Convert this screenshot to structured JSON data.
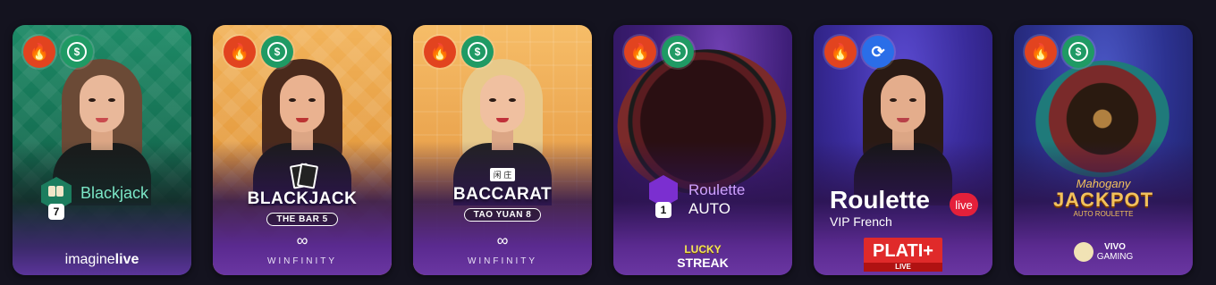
{
  "cards": [
    {
      "id": "blackjack-imagine",
      "badges": [
        "fire-icon",
        "dollar-icon"
      ],
      "title": "Blackjack",
      "chip_number": "7",
      "provider": {
        "pre": "imagine",
        "post": "live"
      }
    },
    {
      "id": "blackjack-the-bar-5",
      "badges": [
        "fire-icon",
        "dollar-icon"
      ],
      "title": "BLACKJACK",
      "subtitle": "THE BAR 5",
      "provider": "WINFINITY"
    },
    {
      "id": "baccarat-tao-yuan-8",
      "badges": [
        "fire-icon",
        "dollar-icon"
      ],
      "chinese": "闲 庄",
      "title": "BACCARAT",
      "subtitle": "TAO YUAN 8",
      "provider": "WINFINITY"
    },
    {
      "id": "roulette-auto",
      "badges": [
        "fire-icon",
        "dollar-icon"
      ],
      "title": "Roulette",
      "subtitle": "AUTO",
      "chip_number": "1",
      "provider": {
        "line1": "LUCKY",
        "line2": "STREAK"
      }
    },
    {
      "id": "roulette-vip-french",
      "badges": [
        "fire-icon",
        "sync-dollar-icon"
      ],
      "title": "Roulette",
      "live": "live",
      "subtitle": "VIP French",
      "provider": {
        "name": "PLATI+",
        "tag": "LIVE"
      }
    },
    {
      "id": "mahogany-jackpot-auto-roulette",
      "badges": [
        "fire-icon",
        "dollar-icon"
      ],
      "title_top": "Mahogany",
      "title": "JACKPOT",
      "subtitle": "AUTO ROULETTE",
      "provider": {
        "name": "VIVO",
        "sub": "GAMING"
      }
    }
  ],
  "colors": {
    "page_bg": "#14131f",
    "fire": "#e2431f",
    "dollar": "#1f9a64",
    "sync": "#2a6ee8",
    "live_red": "#e4203a"
  }
}
